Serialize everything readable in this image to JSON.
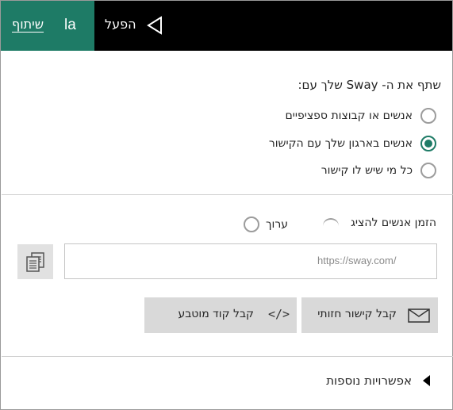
{
  "topbar": {
    "share_label": "שיתוף",
    "initials": "la",
    "play_label": "הפעל"
  },
  "share_section": {
    "title": "שתף את ה- Sway שלך עם:",
    "options": [
      {
        "label": "אנשים או קבוצות ספציפיים",
        "selected": false
      },
      {
        "label": "אנשים בארגון שלך עם הקישור",
        "selected": true
      },
      {
        "label": "כל מי שיש לו קישור",
        "selected": false
      }
    ]
  },
  "invite_section": {
    "invite_label": "הזמן אנשים להציג",
    "edit_label": "ערוך",
    "link_value": "https://sway.com/"
  },
  "actions": {
    "embed_label": "קבל קוד מוטבע",
    "embed_icon": "</>",
    "link_label": "קבל קישור חזותי"
  },
  "more_options": {
    "label": "אפשרויות נוספות"
  },
  "colors": {
    "accent": "#1e7b66",
    "topbar": "#000000",
    "button_bg": "#d9d9d9"
  }
}
